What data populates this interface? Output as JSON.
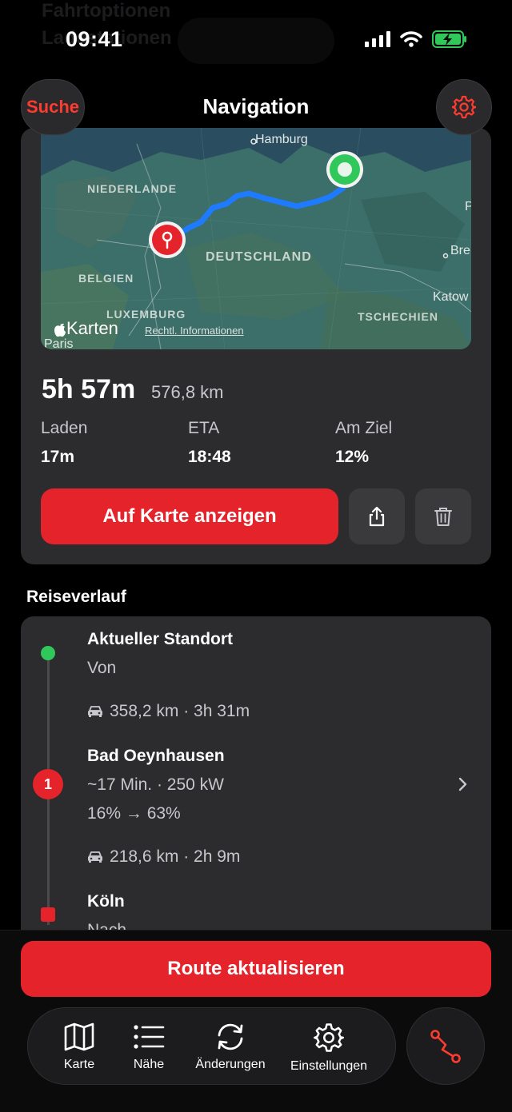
{
  "status_bar": {
    "time": "09:41",
    "ghost_line_1": "Fahrtoptionen",
    "ghost_line_2": "Ladestationen",
    "battery_color": "#30c85a"
  },
  "header": {
    "search_label": "Suche",
    "title": "Navigation",
    "settings_icon": "gear-icon"
  },
  "map": {
    "labels": {
      "hamburg": "Hamburg",
      "niederlande": "NIEDERLANDE",
      "deutschland": "DEUTSCHLAND",
      "belgien": "BELGIEN",
      "luxemburg": "LUXEMBURG",
      "tschechien": "TSCHECHIEN",
      "paris": "Paris",
      "bre": "Bre",
      "katow": "Katow",
      "edge_letter": "P"
    },
    "brand": "Karten",
    "legal": "Rechtl. Informationen",
    "route_color": "#1e7bff"
  },
  "summary": {
    "duration": "5h 57m",
    "distance": "576,8 km",
    "stats": [
      {
        "label": "Laden",
        "value": "17m"
      },
      {
        "label": "ETA",
        "value": "18:48"
      },
      {
        "label": "Am Ziel",
        "value": "12%"
      }
    ],
    "show_on_map_label": "Auf Karte anzeigen"
  },
  "itinerary": {
    "section_title": "Reiseverlauf",
    "start": {
      "title": "Aktueller Standort",
      "subtitle": "Von"
    },
    "leg1": "358,2 km · 3h 31m",
    "stop": {
      "badge": "1",
      "title": "Bad Oeynhausen",
      "detail": "~17 Min. · 250 kW",
      "soc": "16% → 63%"
    },
    "leg2": "218,6 km · 2h 9m",
    "end": {
      "title": "Köln",
      "subtitle": "Nach"
    }
  },
  "actions": {
    "update_route_label": "Route aktualisieren"
  },
  "tabbar": {
    "items": [
      {
        "label": "Karte",
        "icon": "map-icon"
      },
      {
        "label": "Nähe",
        "icon": "list-icon"
      },
      {
        "label": "Änderungen",
        "icon": "refresh-icon"
      },
      {
        "label": "Einstellungen",
        "icon": "gear-icon"
      }
    ],
    "route_icon": "route-icon"
  },
  "colors": {
    "accent": "#e5232a",
    "card": "#2c2c2e",
    "start_dot": "#30c85a"
  }
}
